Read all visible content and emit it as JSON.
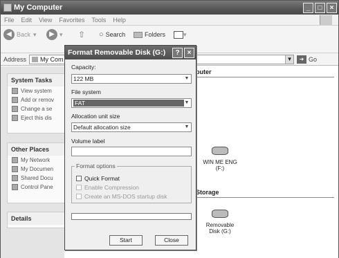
{
  "window": {
    "title": "My Computer"
  },
  "menu": [
    "File",
    "Edit",
    "View",
    "Favorites",
    "Tools",
    "Help"
  ],
  "toolbar": {
    "back": "Back",
    "search": "Search",
    "folders": "Folders"
  },
  "address": {
    "label": "Address",
    "value": "My Com",
    "go": "Go"
  },
  "left": {
    "system_tasks": {
      "title": "System Tasks",
      "items": [
        "View system",
        "Add or remov",
        "Change a se",
        "Eject this dis"
      ]
    },
    "other_places": {
      "title": "Other Places",
      "items": [
        "My Network",
        "My Documen",
        "Shared Docu",
        "Control Pane"
      ]
    },
    "details": {
      "title": "Details"
    }
  },
  "right": {
    "header_frag": "puter",
    "storage_frag": "Storage",
    "drives": [
      {
        "label1": "WIN ME ENG",
        "label2": "(F:)"
      },
      {
        "label1": "Removable",
        "label2": "Disk (G:)"
      }
    ]
  },
  "dialog": {
    "title": "Format Removable Disk (G:)",
    "capacity_label": "Capacity:",
    "capacity_value": "122 MB",
    "fs_label": "File system",
    "fs_value": "FAT",
    "alloc_label": "Allocation unit size",
    "alloc_value": "Default allocation size",
    "vol_label": "Volume label",
    "vol_value": "",
    "group_label": "Format options",
    "quick": "Quick Format",
    "compress": "Enable Compression",
    "msdos": "Create an MS-DOS startup disk",
    "start": "Start",
    "close": "Close"
  }
}
